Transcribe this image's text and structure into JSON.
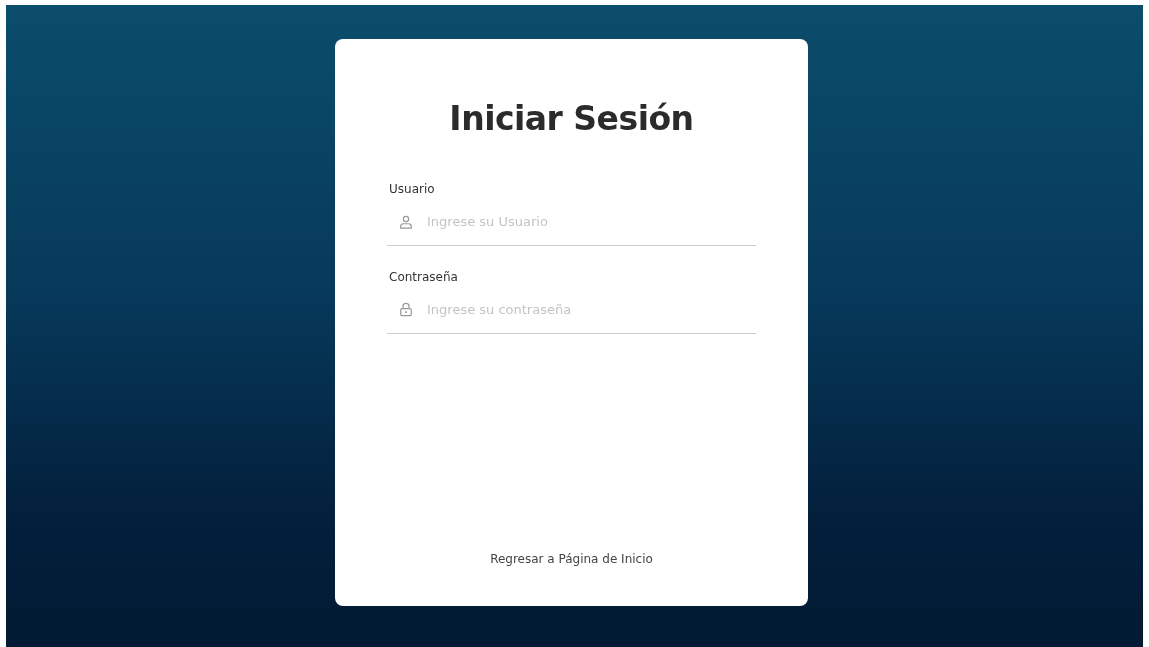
{
  "login_card": {
    "title": "Iniciar Sesión",
    "fields": [
      {
        "label": "Usuario",
        "placeholder": "Ingrese su Usuario",
        "kind": "user"
      },
      {
        "label": "Contraseña",
        "placeholder": "Ingrese su contraseña",
        "kind": "password"
      }
    ],
    "back_link": "Regresar a Página de Inicio"
  }
}
